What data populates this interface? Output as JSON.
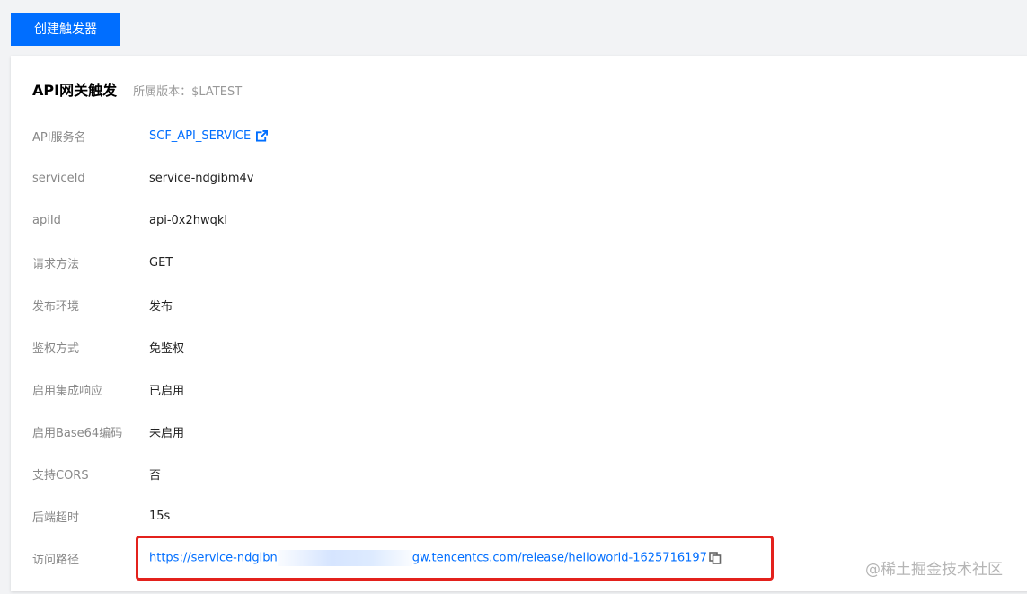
{
  "toolbar": {
    "create_trigger_label": "创建触发器"
  },
  "card": {
    "title": "API网关触发",
    "version_label": "所属版本：",
    "version_value": "$LATEST"
  },
  "fields": [
    {
      "label": "API服务名",
      "value": "SCF_API_SERVICE"
    },
    {
      "label": "serviceId",
      "value": "service-ndgibm4v"
    },
    {
      "label": "apiId",
      "value": "api-0x2hwqkl"
    },
    {
      "label": "请求方法",
      "value": "GET"
    },
    {
      "label": "发布环境",
      "value": "发布"
    },
    {
      "label": "鉴权方式",
      "value": "免鉴权"
    },
    {
      "label": "启用集成响应",
      "value": "已启用"
    },
    {
      "label": "启用Base64编码",
      "value": "未启用"
    },
    {
      "label": "支持CORS",
      "value": "否"
    },
    {
      "label": "后端超时",
      "value": "15s"
    },
    {
      "label": "访问路径",
      "value_prefix": "https://service-ndgibn",
      "value_suffix": "gw.tencentcs.com/release/helloworld-1625716197"
    }
  ],
  "icons": {
    "external_link": "external-link-icon",
    "copy": "copy-icon"
  },
  "colors": {
    "primary": "#006eff",
    "highlight_border": "#e3211c",
    "label": "#888888"
  },
  "watermark": "@稀土掘金技术社区"
}
